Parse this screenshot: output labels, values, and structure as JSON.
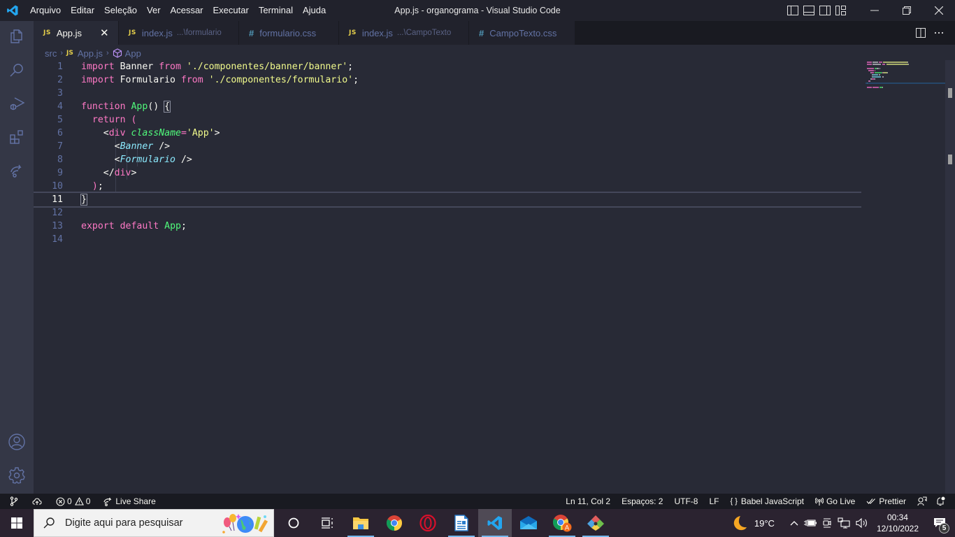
{
  "titlebar": {
    "app_icon": "vscode-logo-icon",
    "menu": [
      "Arquivo",
      "Editar",
      "Seleção",
      "Ver",
      "Acessar",
      "Executar",
      "Terminal",
      "Ajuda"
    ],
    "window_title": "App.js - organograma - Visual Studio Code",
    "layout_controls": [
      "toggle-primary-sidebar-icon",
      "toggle-panel-icon",
      "toggle-secondary-sidebar-icon",
      "customize-layout-icon"
    ],
    "window_controls": [
      "minimize-icon",
      "restore-icon",
      "close-icon"
    ]
  },
  "activitybar": {
    "top": [
      {
        "name": "explorer",
        "icon": "files-icon"
      },
      {
        "name": "search",
        "icon": "search-icon"
      },
      {
        "name": "run-debug",
        "icon": "debug-icon"
      },
      {
        "name": "extensions",
        "icon": "extensions-icon"
      },
      {
        "name": "live-share",
        "icon": "live-share-icon"
      }
    ],
    "bottom": [
      {
        "name": "accounts",
        "icon": "account-icon"
      },
      {
        "name": "manage",
        "icon": "gear-icon"
      }
    ]
  },
  "tabs": [
    {
      "label": "App.js",
      "type": "js",
      "description": "",
      "active": true
    },
    {
      "label": "index.js",
      "type": "js",
      "description": "...\\formulario",
      "active": false
    },
    {
      "label": "formulario.css",
      "type": "css",
      "description": "",
      "active": false
    },
    {
      "label": "index.js",
      "type": "js",
      "description": "...\\CampoTexto",
      "active": false
    },
    {
      "label": "CampoTexto.css",
      "type": "css",
      "description": "",
      "active": false
    }
  ],
  "tab_icons": {
    "js": "JS",
    "css": "#",
    "close": "✕"
  },
  "tab_actions": [
    "split-editor-icon",
    "more-actions-icon"
  ],
  "breadcrumb": {
    "folder": "src",
    "file": "App.js",
    "symbol": "App",
    "sep": "›"
  },
  "editor": {
    "current_line": 11,
    "lines": [
      {
        "n": "1",
        "tokens": [
          [
            "kw",
            "import"
          ],
          [
            "id",
            " Banner "
          ],
          [
            "kw",
            "from"
          ],
          [
            "id",
            " "
          ],
          [
            "str",
            "'./componentes/banner/banner'"
          ],
          [
            "punc",
            ";"
          ]
        ]
      },
      {
        "n": "2",
        "tokens": [
          [
            "kw",
            "import"
          ],
          [
            "id",
            " Formulario "
          ],
          [
            "kw",
            "from"
          ],
          [
            "id",
            " "
          ],
          [
            "str",
            "'./componentes/formulario'"
          ],
          [
            "punc",
            ";"
          ]
        ]
      },
      {
        "n": "3",
        "tokens": []
      },
      {
        "n": "4",
        "tokens": [
          [
            "kw",
            "function"
          ],
          [
            "id",
            " "
          ],
          [
            "fn",
            "App"
          ],
          [
            "punc",
            "() "
          ],
          [
            "punc bracket-box",
            "{"
          ]
        ]
      },
      {
        "n": "5",
        "tokens": [
          [
            "id",
            "  "
          ],
          [
            "kw",
            "return"
          ],
          [
            "id",
            " "
          ],
          [
            "paren",
            "("
          ]
        ]
      },
      {
        "n": "6",
        "tokens": [
          [
            "id",
            "    "
          ],
          [
            "punc",
            "<"
          ],
          [
            "kw",
            "div"
          ],
          [
            "id",
            " "
          ],
          [
            "attr",
            "className"
          ],
          [
            "kw",
            "="
          ],
          [
            "str",
            "'App'"
          ],
          [
            "punc",
            ">"
          ]
        ]
      },
      {
        "n": "7",
        "tokens": [
          [
            "id",
            "      "
          ],
          [
            "punc",
            "<"
          ],
          [
            "comp",
            "Banner"
          ],
          [
            "id",
            " "
          ],
          [
            "punc",
            "/>"
          ]
        ]
      },
      {
        "n": "8",
        "tokens": [
          [
            "id",
            "      "
          ],
          [
            "punc",
            "<"
          ],
          [
            "comp",
            "Formulario"
          ],
          [
            "id",
            " "
          ],
          [
            "punc",
            "/>"
          ]
        ]
      },
      {
        "n": "9",
        "tokens": [
          [
            "id",
            "    "
          ],
          [
            "punc",
            "</"
          ],
          [
            "kw",
            "div"
          ],
          [
            "punc",
            ">"
          ]
        ]
      },
      {
        "n": "10",
        "tokens": [
          [
            "id",
            "  "
          ],
          [
            "paren",
            ")"
          ],
          [
            "punc",
            ";"
          ]
        ]
      },
      {
        "n": "11",
        "tokens": [
          [
            "punc bracket-box",
            "}"
          ]
        ]
      },
      {
        "n": "12",
        "tokens": []
      },
      {
        "n": "13",
        "tokens": [
          [
            "kw",
            "export"
          ],
          [
            "id",
            " "
          ],
          [
            "kw",
            "default"
          ],
          [
            "id",
            " "
          ],
          [
            "fn",
            "App"
          ],
          [
            "punc",
            ";"
          ]
        ]
      },
      {
        "n": "14",
        "tokens": []
      }
    ]
  },
  "statusbar": {
    "left": [
      {
        "name": "source-control",
        "icon": "git-branch-icon",
        "text": ""
      },
      {
        "name": "publish",
        "icon": "cloud-upload-icon",
        "text": ""
      },
      {
        "name": "problems",
        "icon": "error-icon",
        "errors": "0",
        "warnings": "0"
      },
      {
        "name": "live-share",
        "icon": "live-share-icon",
        "text": "Live Share"
      }
    ],
    "right": [
      {
        "name": "cursor-position",
        "text": "Ln 11, Col 2"
      },
      {
        "name": "indentation",
        "text": "Espaços: 2"
      },
      {
        "name": "encoding",
        "text": "UTF-8"
      },
      {
        "name": "eol",
        "text": "LF"
      },
      {
        "name": "language-mode",
        "icon": "braces-icon",
        "text": "Babel JavaScript"
      },
      {
        "name": "go-live",
        "icon": "broadcast-icon",
        "text": "Go Live"
      },
      {
        "name": "prettier",
        "icon": "double-check-icon",
        "text": "Prettier"
      },
      {
        "name": "feedback",
        "icon": "feedback-icon",
        "text": ""
      },
      {
        "name": "notifications",
        "icon": "bell-icon",
        "text": ""
      }
    ]
  },
  "taskbar": {
    "search_placeholder": "Digite aqui para pesquisar",
    "apps": [
      {
        "name": "cortana",
        "icon": "circle-icon",
        "running": false,
        "active": false
      },
      {
        "name": "task-view",
        "icon": "task-view-icon",
        "running": false,
        "active": false
      },
      {
        "name": "file-explorer",
        "icon": "folder-icon",
        "running": true,
        "active": false
      },
      {
        "name": "chrome",
        "icon": "chrome-icon",
        "running": false,
        "active": false
      },
      {
        "name": "opera",
        "icon": "opera-icon",
        "running": false,
        "active": false
      },
      {
        "name": "libreoffice-writer",
        "icon": "writer-icon",
        "running": true,
        "active": false
      },
      {
        "name": "vscode",
        "icon": "vscode-icon",
        "running": true,
        "active": true
      },
      {
        "name": "mail",
        "icon": "mail-icon",
        "running": false,
        "active": false
      },
      {
        "name": "chrome-profile",
        "icon": "chrome-profile-icon",
        "running": true,
        "active": false
      },
      {
        "name": "git-gui",
        "icon": "git-gui-icon",
        "running": true,
        "active": false
      }
    ],
    "weather": {
      "icon": "moon-icon",
      "temp": "19°C"
    },
    "tray_icons": [
      "chevron-up-icon",
      "battery-icon",
      "camera-icon",
      "network-icon",
      "volume-icon"
    ],
    "clock": {
      "time": "00:34",
      "date": "12/10/2022"
    },
    "notifications_count": "5"
  }
}
